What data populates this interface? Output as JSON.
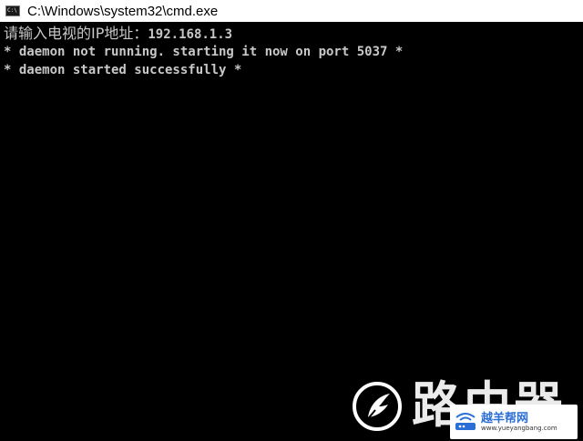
{
  "window": {
    "title": "C:\\Windows\\system32\\cmd.exe",
    "icon": "cmd-icon"
  },
  "console": {
    "lines": [
      {
        "prompt": "请输入电视的IP地址：",
        "value": "192.168.1.3"
      },
      {
        "text": "* daemon not running. starting it now on port 5037 *"
      },
      {
        "text": "* daemon started successfully *"
      }
    ]
  },
  "watermark": {
    "icon": "feather-logo-icon",
    "chars": "路由器",
    "badge_name": "越羊帮网",
    "badge_url": "www.yueyangbang.com"
  },
  "colors": {
    "console_bg": "#000000",
    "console_text": "#c8c8c8",
    "titlebar_bg": "#ffffff",
    "badge_text": "#2b6fd6"
  }
}
